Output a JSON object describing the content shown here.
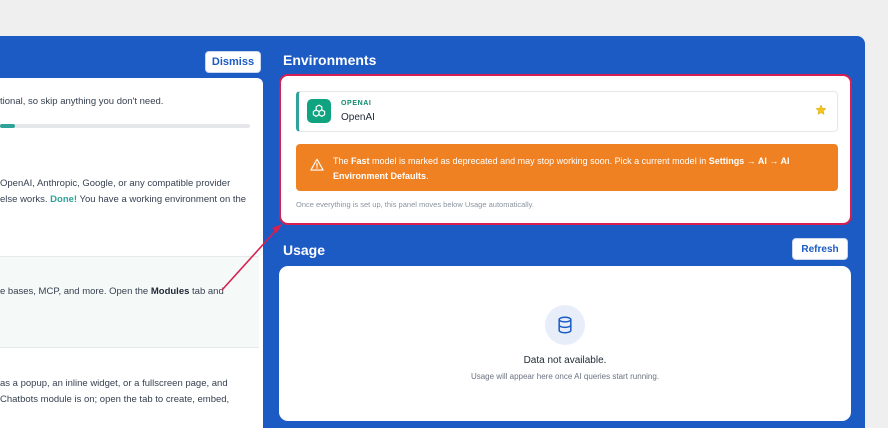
{
  "onboarding": {
    "dismiss_label": "Dismiss",
    "intro_text": "tional, so skip anything you don't need.",
    "progress_fraction": 0.06,
    "step1_line1": "OpenAI, Anthropic, Google, or any compatible provider",
    "step1_line2a": "else works. ",
    "step1_done": "Done!",
    "step1_line2b": " You have a working environment on the",
    "step2_line1a": "e bases, MCP, and more. Open the ",
    "step2_modules": "Modules",
    "step2_line1b": " tab and",
    "step3_line1": "as a popup, an inline widget, or a fullscreen page, and",
    "step3_line2": "Chatbots module is on; open the tab to create, embed,"
  },
  "environments": {
    "title": "Environments",
    "provider_kicker": "OPENAI",
    "provider_name": "OpenAI",
    "warning_text_a": "The ",
    "warning_fast": "Fast",
    "warning_text_b": " model is marked as deprecated and may stop working soon. Pick a current model in ",
    "warning_path": "Settings → AI → AI Environment Defaults",
    "warning_text_c": ".",
    "note": "Once everything is set up, this panel moves below Usage automatically."
  },
  "usage": {
    "title": "Usage",
    "refresh_label": "Refresh",
    "empty_title": "Data not available.",
    "empty_hint": "Usage will appear here once AI queries start running."
  },
  "colors": {
    "panel_blue": "#1c5ac4",
    "accent_teal": "#2fa39a",
    "warning_orange": "#f08122",
    "highlight_red": "#d81f4f"
  }
}
